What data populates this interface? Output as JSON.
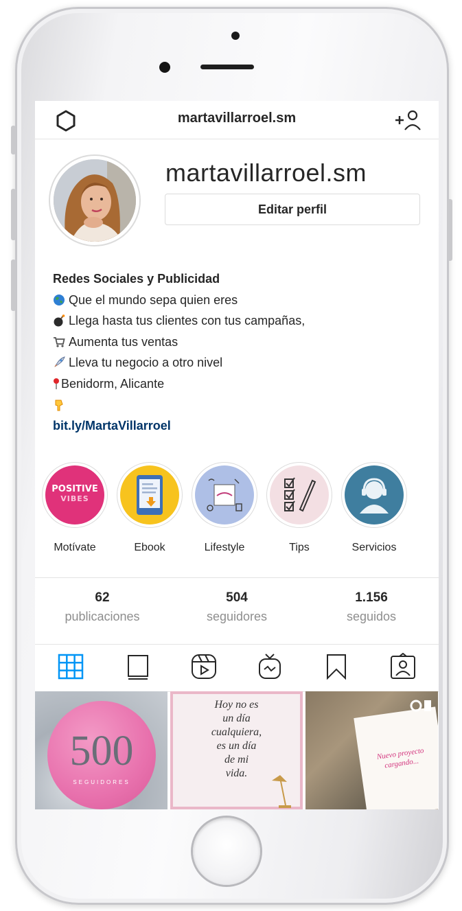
{
  "header": {
    "username": "martavillarroel.sm"
  },
  "profile": {
    "name": "martavillarroel.sm",
    "edit_button": "Editar perfil"
  },
  "bio": {
    "title": "Redes Sociales y Publicidad",
    "lines": [
      {
        "icon": "globe-emoji",
        "text": "Que el mundo sepa quien eres"
      },
      {
        "icon": "bomb-emoji",
        "text": "Llega hasta tus clientes con tus campañas,"
      },
      {
        "icon": "shopping-cart-emoji",
        "text": "Aumenta tus ventas"
      },
      {
        "icon": "rocket-emoji",
        "text": "Lleva tu negocio a otro nivel"
      },
      {
        "icon": "pin-emoji",
        "text": "Benidorm, Alicante"
      },
      {
        "icon": "pointing-down-emoji",
        "text": ""
      }
    ],
    "link": "bit.ly/MartaVillarroel"
  },
  "highlights": [
    {
      "label": "Motívate",
      "cover_text": [
        "POSITIVE",
        "VIBES"
      ],
      "color": "#e0327a"
    },
    {
      "label": "Ebook",
      "color": "#f7c31e"
    },
    {
      "label": "Lifestyle",
      "color": "#aebfe6"
    },
    {
      "label": "Tips",
      "color": "#f3dfe3"
    },
    {
      "label": "Servicios",
      "color": "#3f7e9f"
    }
  ],
  "stats": [
    {
      "value": "62",
      "label": "publicaciones"
    },
    {
      "value": "504",
      "label": "seguidores"
    },
    {
      "value": "1.156",
      "label": "seguidos"
    }
  ],
  "tabs": [
    "grid-icon",
    "feed-icon",
    "reels-icon",
    "igtv-icon",
    "saved-icon",
    "tagged-icon"
  ],
  "posts": [
    {
      "big_text": "500",
      "small_text": "SEGUIDORES"
    },
    {
      "text_lines": [
        "Hoy no es",
        "un día",
        "cualquiera,",
        "es un día",
        "de mi",
        "vida."
      ]
    },
    {
      "text_lines": [
        "Nuevo proyecto",
        "cargando..."
      ]
    }
  ],
  "colors": {
    "accent_blue": "#0095f6",
    "link_blue": "#003569",
    "text": "#262626",
    "muted": "#8e8e8e"
  }
}
